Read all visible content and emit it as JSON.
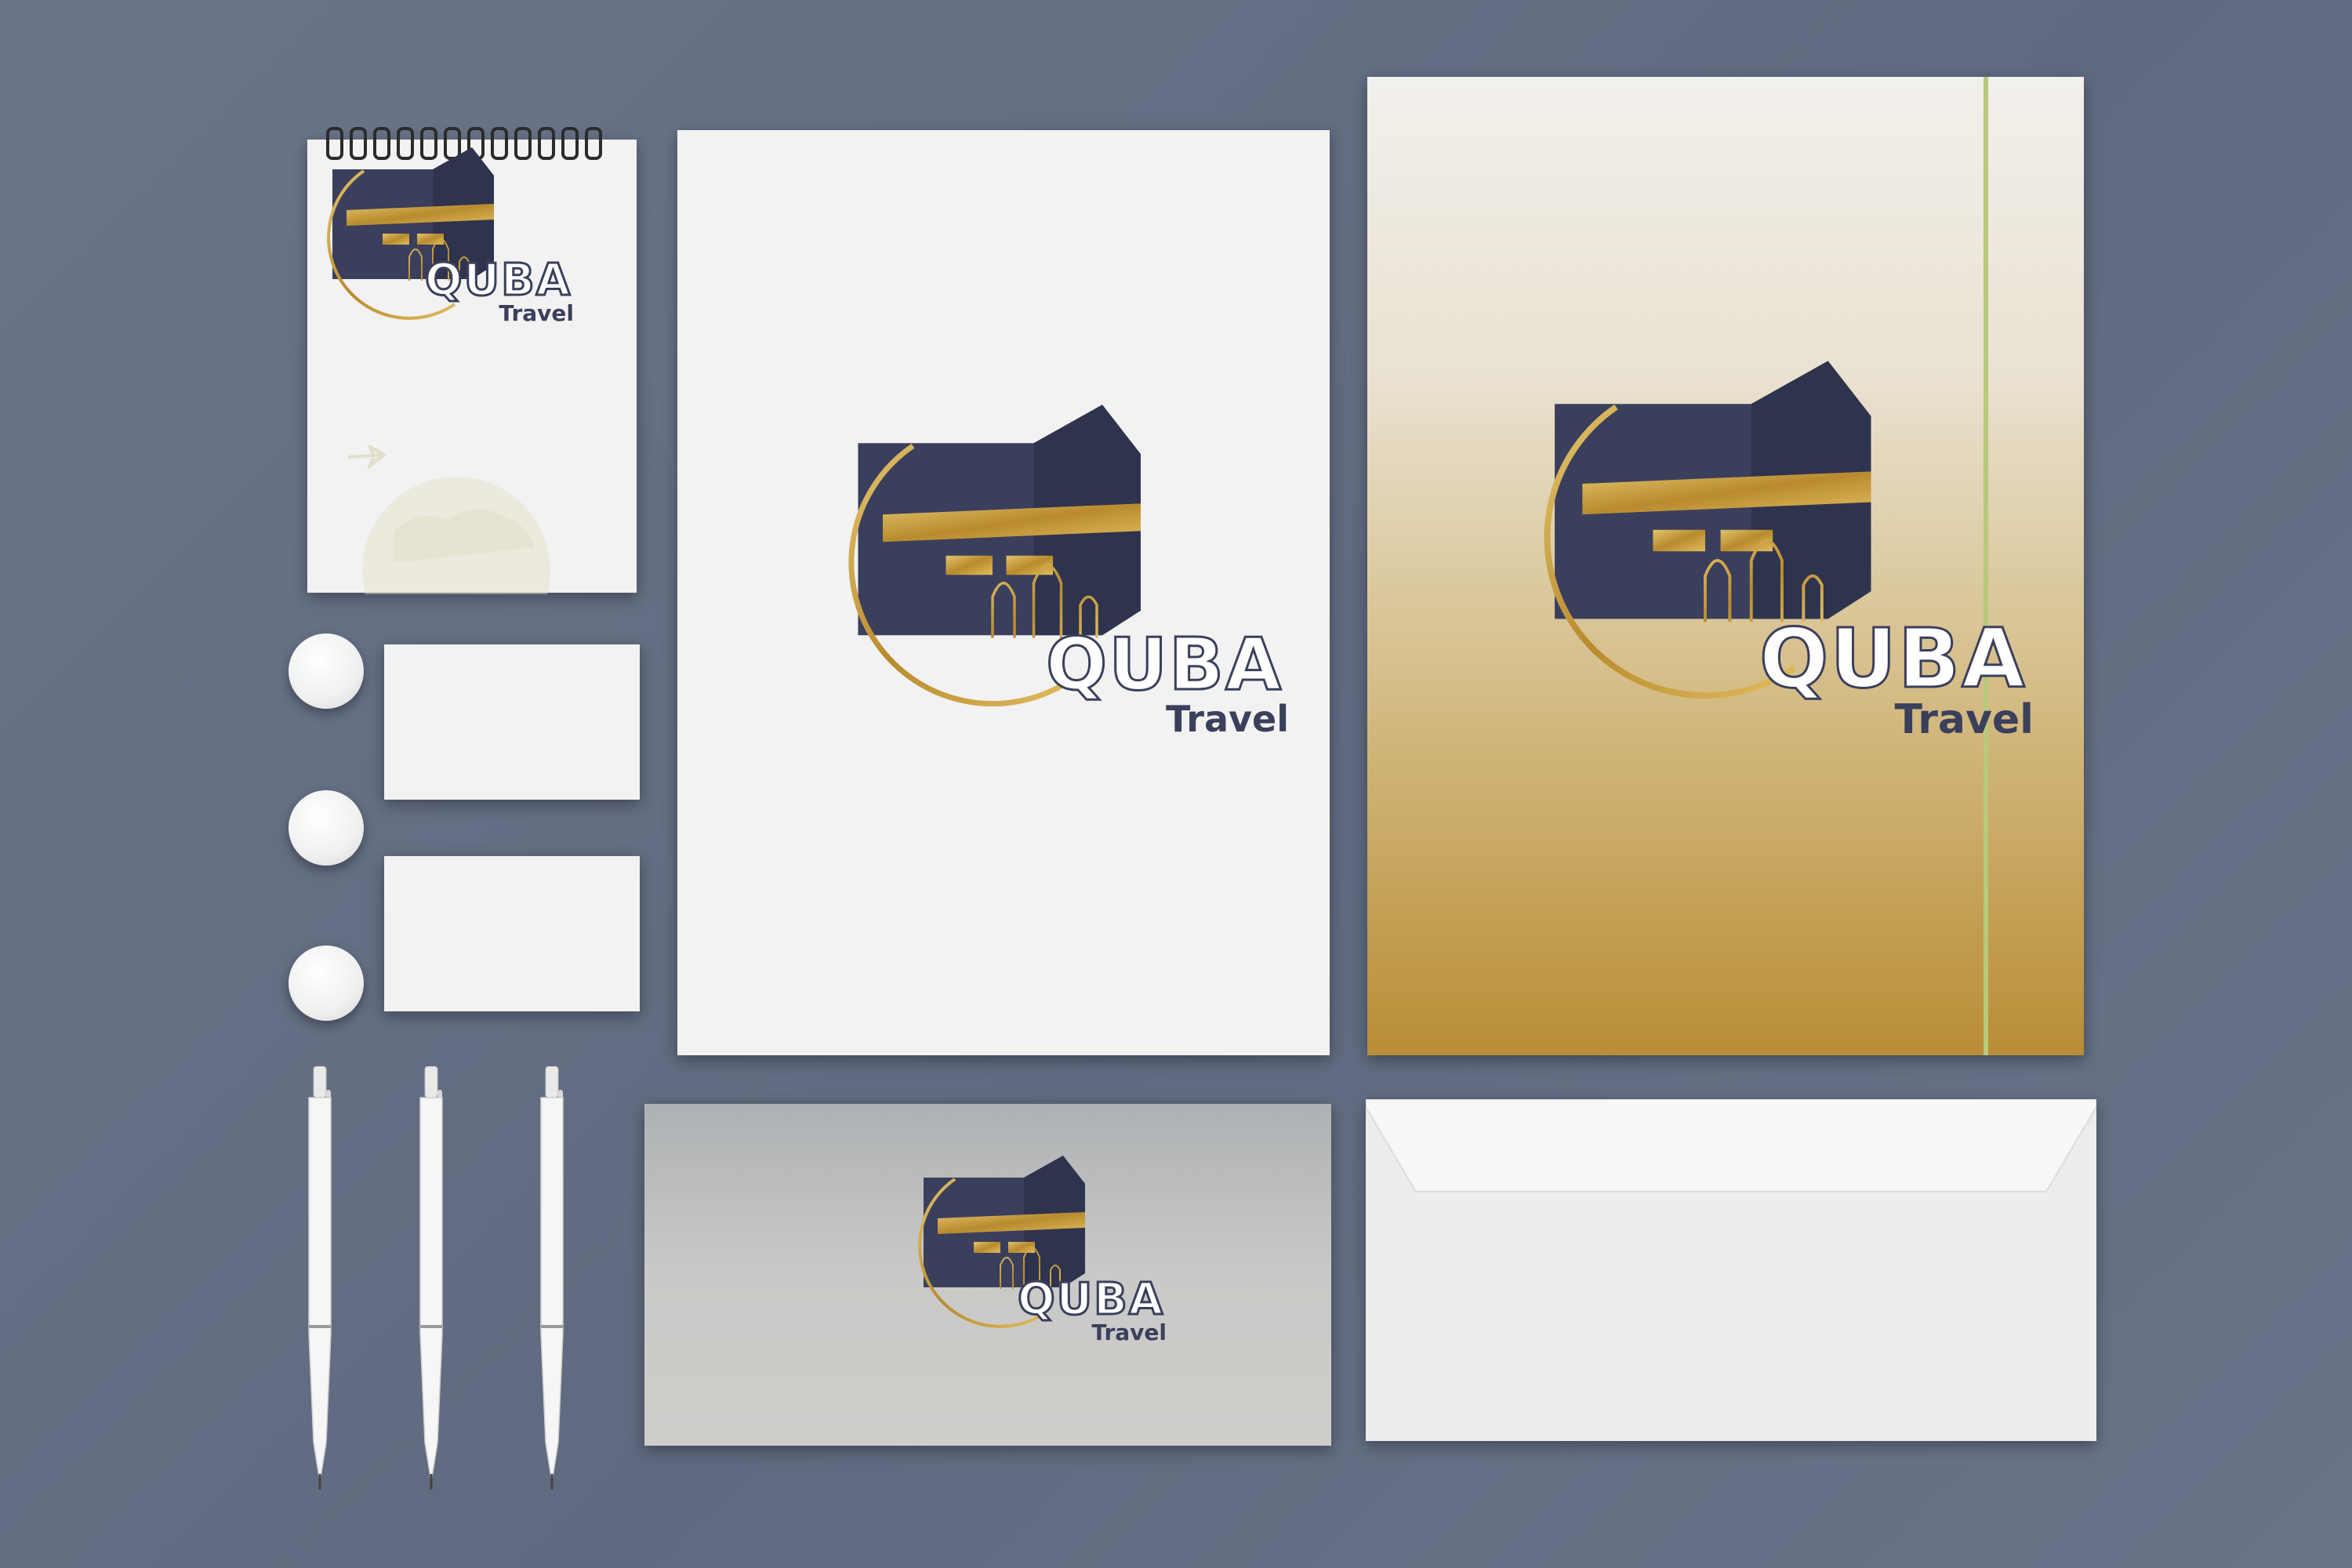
{
  "brand": {
    "name": "QUBA",
    "tagline": "Travel",
    "colors": {
      "navy": "#3a3f5c",
      "gold": "#c29638",
      "background": "#657087"
    }
  },
  "notepad": {
    "footer": [
      "",
      "",
      ""
    ]
  },
  "icons": [
    "kaaba-crescent-logo",
    "airplane-icon",
    "globe-icon",
    "pen-icon"
  ]
}
